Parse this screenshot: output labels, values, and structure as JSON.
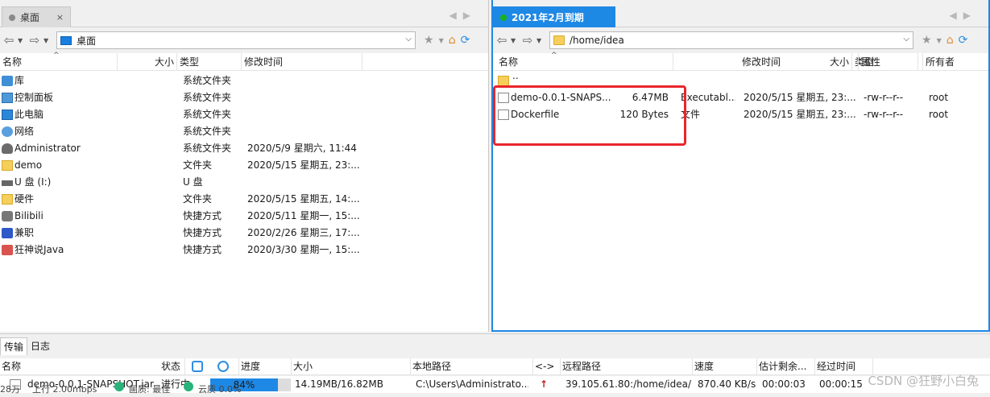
{
  "left": {
    "tab_label": "桌面",
    "tab_close": "×",
    "address": "桌面",
    "columns": [
      "名称",
      "大小",
      "类型",
      "修改时间"
    ],
    "rows": [
      {
        "icon": "library-icon",
        "cls": "ic-lib",
        "name": "库",
        "size": "",
        "type": "系统文件夹",
        "mtime": ""
      },
      {
        "icon": "control-panel-icon",
        "cls": "ic-panel",
        "name": "控制面板",
        "size": "",
        "type": "系统文件夹",
        "mtime": ""
      },
      {
        "icon": "computer-icon",
        "cls": "ic-pc",
        "name": "此电脑",
        "size": "",
        "type": "系统文件夹",
        "mtime": ""
      },
      {
        "icon": "network-icon",
        "cls": "ic-net",
        "name": "网络",
        "size": "",
        "type": "系统文件夹",
        "mtime": ""
      },
      {
        "icon": "user-icon",
        "cls": "ic-user",
        "name": "Administrator",
        "size": "",
        "type": "系统文件夹",
        "mtime": "2020/5/9 星期六, 11:44"
      },
      {
        "icon": "folder-icon",
        "cls": "ic-folder",
        "name": "demo",
        "size": "",
        "type": "文件夹",
        "mtime": "2020/5/15 星期五, 23:..."
      },
      {
        "icon": "drive-icon",
        "cls": "ic-drive",
        "name": "U 盘 (I:)",
        "size": "",
        "type": "U 盘",
        "mtime": ""
      },
      {
        "icon": "folder-icon",
        "cls": "ic-folder",
        "name": "硬件",
        "size": "",
        "type": "文件夹",
        "mtime": "2020/5/15 星期五, 14:..."
      },
      {
        "icon": "shortcut-icon",
        "cls": "ic-shortcut",
        "name": "Bilibili",
        "size": "",
        "type": "快捷方式",
        "mtime": "2020/5/11 星期一, 15:..."
      },
      {
        "icon": "app-icon",
        "cls": "ic-app",
        "name": "兼职",
        "size": "",
        "type": "快捷方式",
        "mtime": "2020/2/26 星期三, 17:..."
      },
      {
        "icon": "java-icon",
        "cls": "ic-java",
        "name": "狂神说Java",
        "size": "",
        "type": "快捷方式",
        "mtime": "2020/3/30 星期一, 15:..."
      }
    ]
  },
  "right": {
    "tab_label": "2021年2月到期",
    "address": "/home/idea",
    "columns": [
      "名称",
      "大小",
      "类型",
      "修改时间",
      "属性",
      "所有者"
    ],
    "parent_dir": "..",
    "rows": [
      {
        "icon": "jar-file-icon",
        "cls": "ic-jar",
        "name": "demo-0.0.1-SNAPS...",
        "size": "6.47MB",
        "type": "Executabl...",
        "mtime": "2020/5/15 星期五, 23:...",
        "attr": "-rw-r--r--",
        "owner": "root"
      },
      {
        "icon": "file-icon",
        "cls": "ic-file",
        "name": "Dockerfile",
        "size": "120 Bytes",
        "type": "文件",
        "mtime": "2020/5/15 星期五, 23:...",
        "attr": "-rw-r--r--",
        "owner": "root"
      }
    ]
  },
  "bottom": {
    "tabs": [
      "传输",
      "日志"
    ],
    "columns": [
      "名称",
      "状态",
      "进度",
      "大小",
      "本地路径",
      "<->",
      "远程路径",
      "速度",
      "估计剩余...",
      "经过时间"
    ],
    "transfer": {
      "name": "demo-0.0.1-SNAPSHOT.jar",
      "status": "进行中",
      "progress": 84,
      "progress_label": "84%",
      "size": "14.19MB/16.82MB",
      "local_path": "C:\\Users\\Administrato...",
      "direction": "↑",
      "remote_path": "39.105.61.80:/home/idea/...",
      "speed": "870.40 KB/s",
      "remaining": "00:00:03",
      "elapsed": "00:00:15"
    },
    "status_strip": {
      "left": "28万",
      "upload": "上行 2.00mbps",
      "down": "画质: 最佳",
      "cloud": "云质 0.0%"
    }
  },
  "watermark": "CSDN @狂野小白兔"
}
